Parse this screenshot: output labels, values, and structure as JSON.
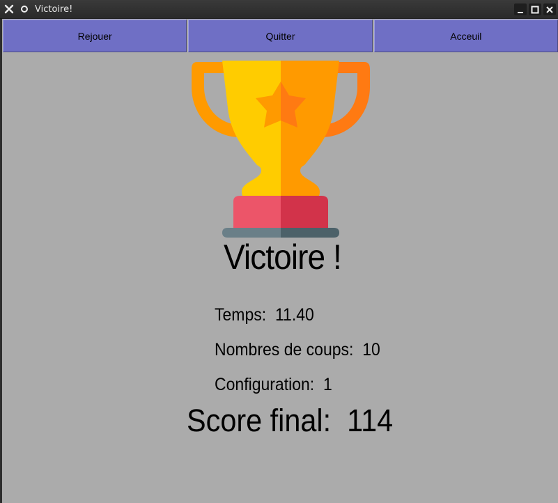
{
  "window": {
    "title": "Victoire!"
  },
  "toolbar": {
    "buttons": [
      {
        "label": "Rejouer"
      },
      {
        "label": "Quitter"
      },
      {
        "label": "Acceuil"
      }
    ]
  },
  "result": {
    "heading": "Victoire !",
    "time_label": "Temps:",
    "time_value": "11.40",
    "moves_label": "Nombres de coups:",
    "moves_value": "10",
    "config_label": "Configuration:",
    "config_value": "1",
    "score_label": "Score final:",
    "score_value": "114"
  },
  "icons": {
    "trophy": "trophy-icon"
  },
  "colors": {
    "button_bg": "#6f6fc5",
    "window_bg": "#ababab",
    "trophy_gold": "#ffcc00",
    "trophy_orange": "#ff9a00",
    "trophy_base_red": "#ec5569",
    "trophy_base_dark": "#546e7a"
  }
}
